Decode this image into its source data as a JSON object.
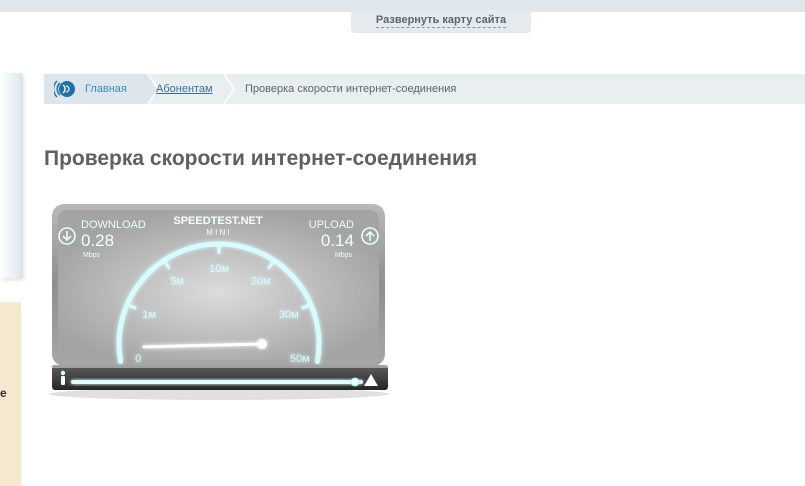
{
  "header": {
    "sitemap_link": "Развернуть карту сайта"
  },
  "sidebar": {
    "cut_label": "е"
  },
  "breadcrumb": {
    "home": "Главная",
    "subscribers": "Абонентам",
    "current": "Проверка скорости интернет-соединения"
  },
  "page": {
    "title": "Проверка скорости интернет-соединения"
  },
  "speedtest": {
    "brand": "SPEEDTEST.NET",
    "brand_sub": "M I N I",
    "download": {
      "label": "DOWNLOAD",
      "value": "0.28",
      "unit": "Mbps"
    },
    "upload": {
      "label": "UPLOAD",
      "value": "0.14",
      "unit": "Mbps"
    },
    "scale": [
      "0",
      "1м",
      "5м",
      "10м",
      "20м",
      "30м",
      "50м"
    ],
    "needle_value_mbps": 0.28,
    "progress_fraction": 1.0,
    "colors": {
      "accent": "#d8fbff",
      "glow": "#6fe6f0",
      "panel": "#9a9a9a"
    }
  }
}
